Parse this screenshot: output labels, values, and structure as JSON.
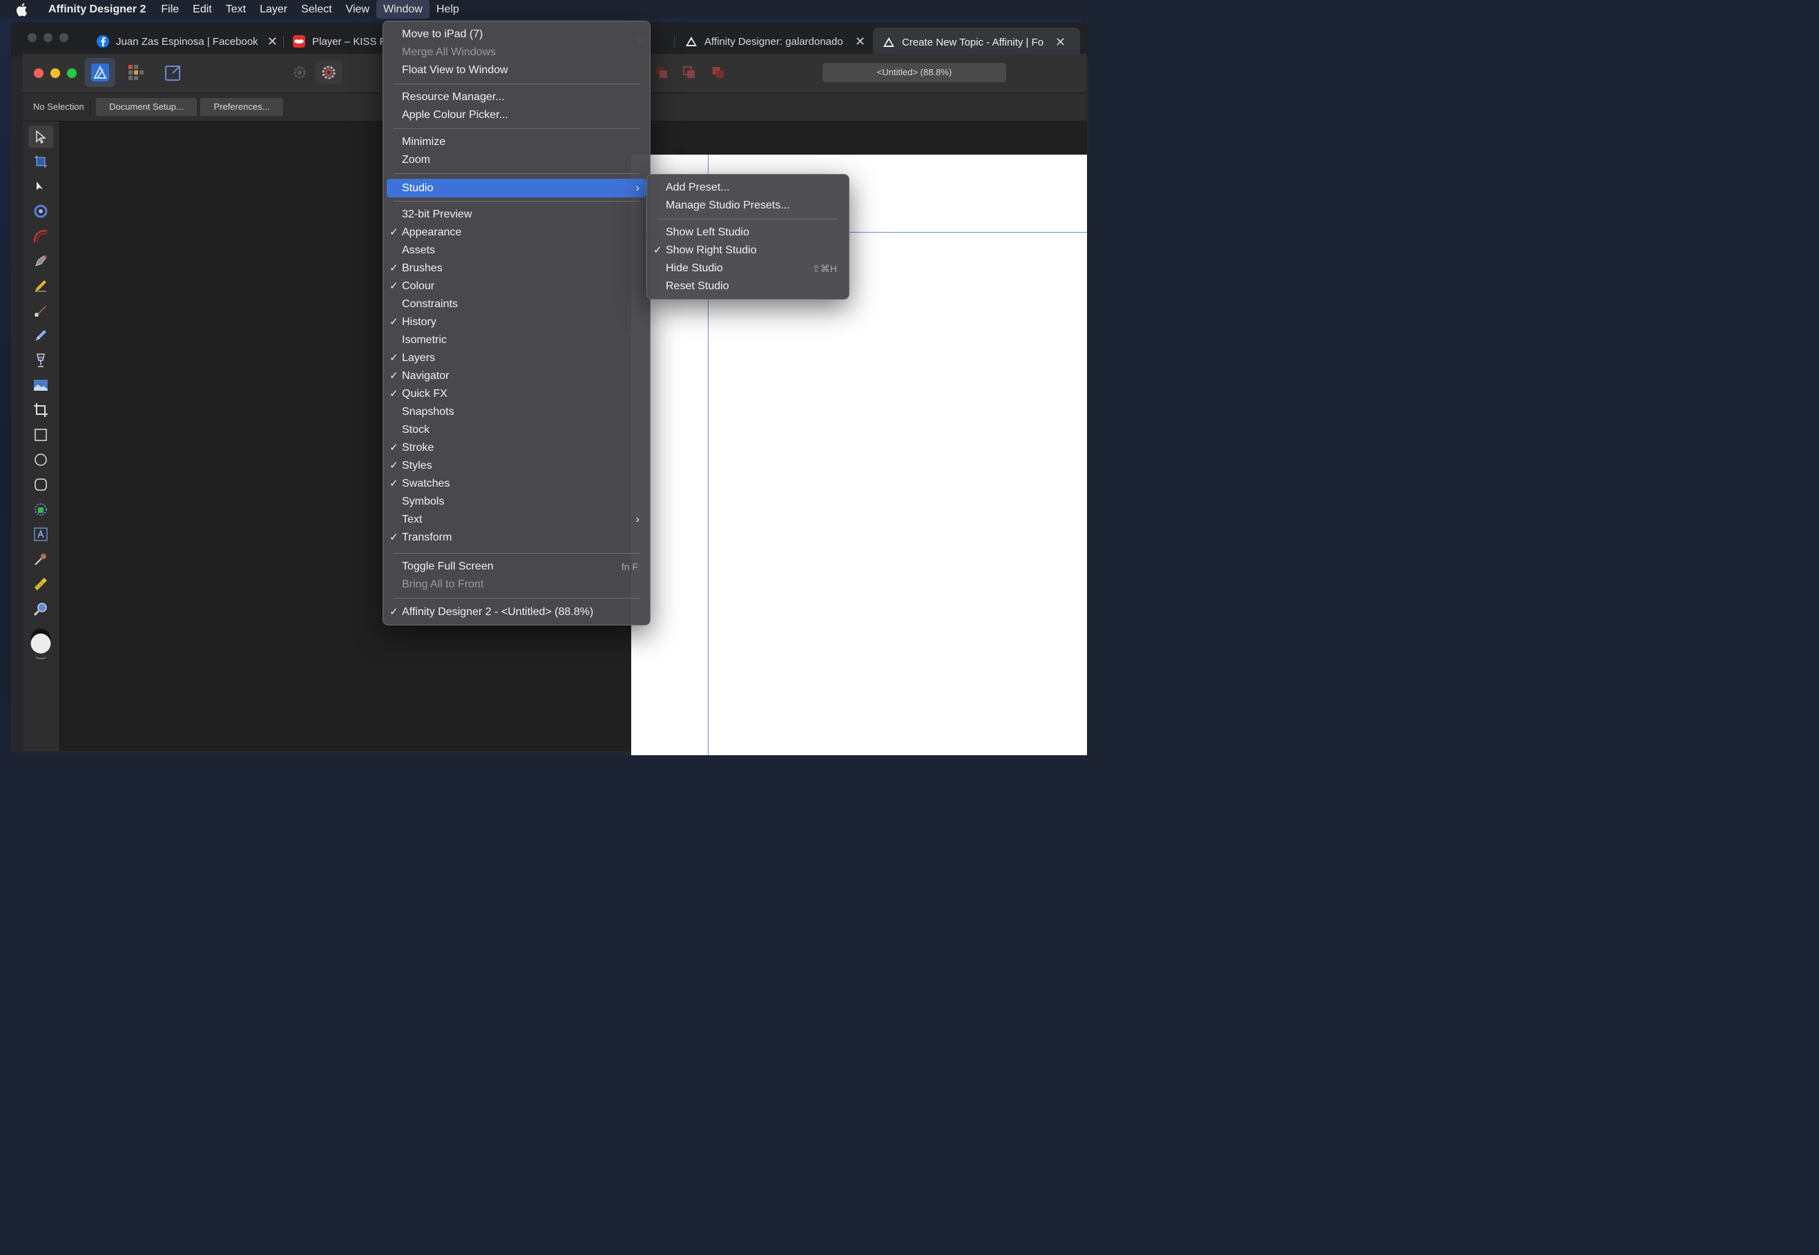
{
  "menubar": {
    "app_name": "Affinity Designer 2",
    "items": [
      "File",
      "Edit",
      "Text",
      "Layer",
      "Select",
      "View",
      "Window",
      "Help"
    ],
    "active": "Window"
  },
  "browser": {
    "tabs": [
      {
        "title": "Juan Zas Espinosa | Facebook"
      },
      {
        "title": "Player – KISS F"
      },
      {
        "title": "Affinity Designer: galardonado"
      },
      {
        "title": "Create New Topic - Affinity | Fo"
      }
    ]
  },
  "affinity": {
    "doc_title": "<Untitled> (88.8%)",
    "context": {
      "selection_label": "No Selection",
      "doc_setup": "Document Setup...",
      "preferences": "Preferences..."
    }
  },
  "window_menu": {
    "items": {
      "move_to_ipad": "Move to iPad (7)",
      "merge_all": "Merge All Windows",
      "float_view": "Float View to Window",
      "resource_manager": "Resource Manager...",
      "apple_colour": "Apple Colour Picker...",
      "minimize": "Minimize",
      "zoom": "Zoom",
      "studio": "Studio",
      "preview32": "32-bit Preview",
      "appearance": "Appearance",
      "assets": "Assets",
      "brushes": "Brushes",
      "colour": "Colour",
      "constraints": "Constraints",
      "history": "History",
      "isometric": "Isometric",
      "layers": "Layers",
      "navigator": "Navigator",
      "quickfx": "Quick FX",
      "snapshots": "Snapshots",
      "stock": "Stock",
      "stroke": "Stroke",
      "styles": "Styles",
      "swatches": "Swatches",
      "symbols": "Symbols",
      "text": "Text",
      "transform": "Transform",
      "toggle_fullscreen": "Toggle Full Screen",
      "toggle_fullscreen_shortcut": "fn F",
      "bring_all_front": "Bring All to Front",
      "doc_window": "Affinity Designer 2 - <Untitled> (88.8%)"
    },
    "check": "✓",
    "arrow": "›"
  },
  "studio_menu": {
    "add_preset": "Add Preset...",
    "manage_presets": "Manage Studio Presets...",
    "show_left": "Show Left Studio",
    "show_right": "Show Right Studio",
    "hide_studio": "Hide Studio",
    "hide_shortcut": "⇧⌘H",
    "reset_studio": "Reset Studio"
  },
  "colors": {
    "highlight": "#3d73d9",
    "menu_bg": "#4a4a4e",
    "canvas": "#202020",
    "guide": "#6b8bd6"
  }
}
